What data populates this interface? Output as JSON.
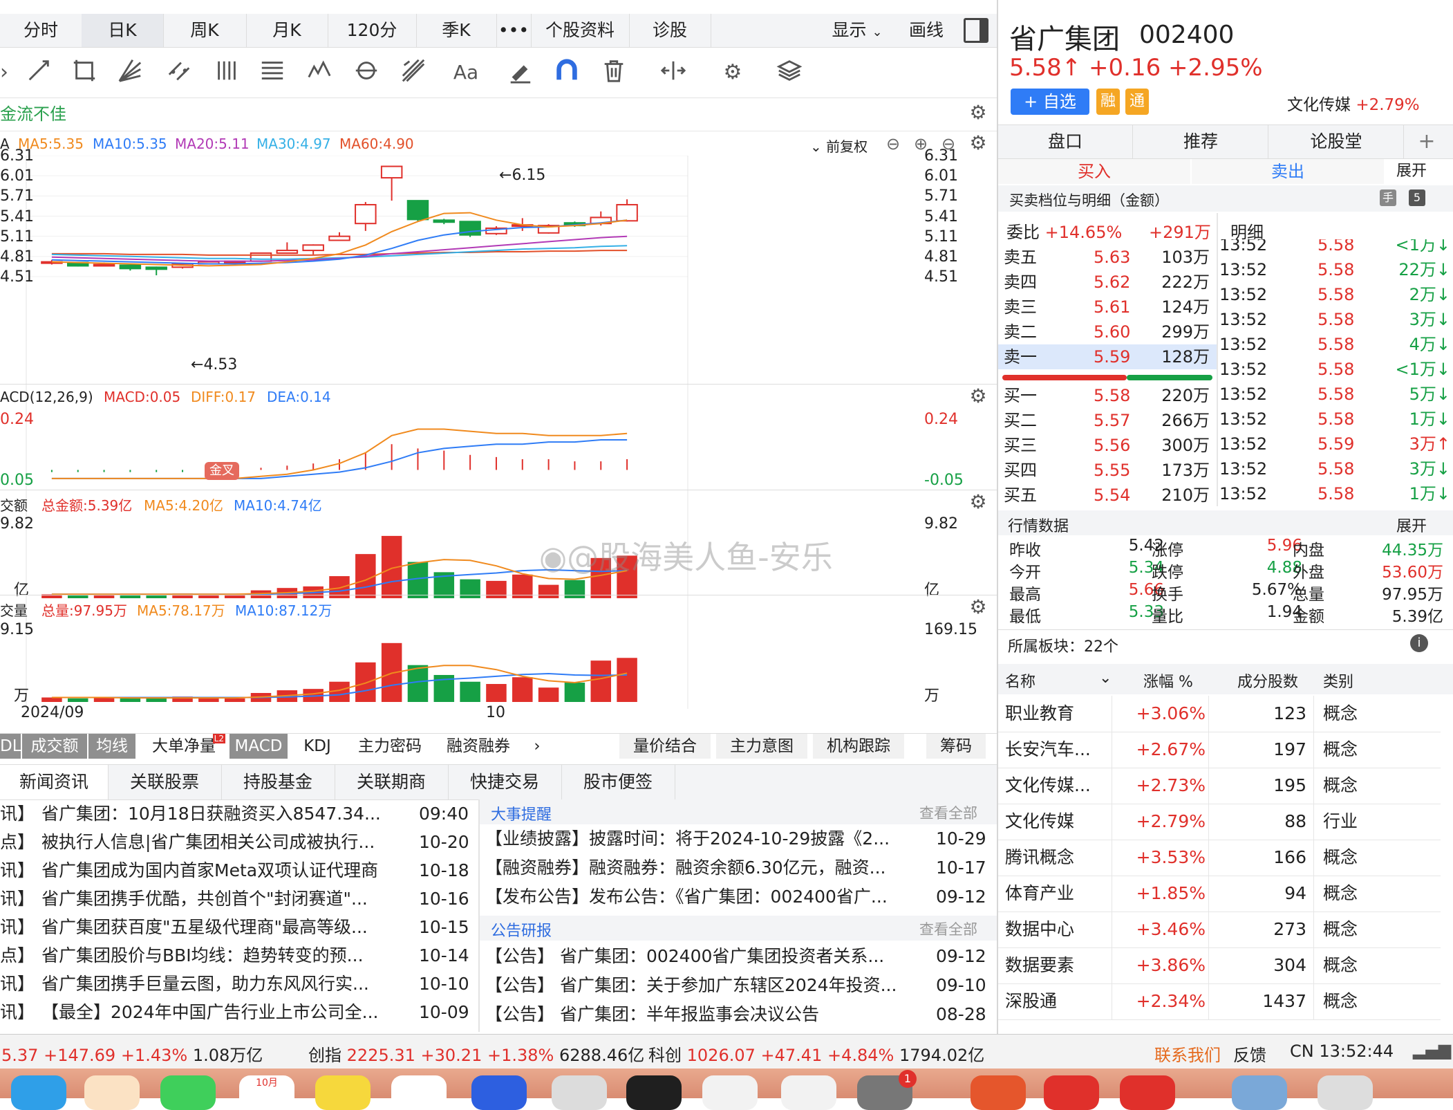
{
  "top_tabs": [
    "分时",
    "日K",
    "周K",
    "月K",
    "120分",
    "季K",
    "•••",
    "个股资料",
    "诊股"
  ],
  "top_right": {
    "display_label": "显示",
    "draw_label": "画线"
  },
  "signal_text": "金流不佳",
  "ma_line": {
    "prefix": "A",
    "ma5": "MA5:5.35",
    "ma10": "MA10:5.35",
    "ma20": "MA20:5.11",
    "ma30": "MA30:4.97",
    "ma60": "MA60:4.90",
    "adjust": "前复权"
  },
  "colors": {
    "up": "#e0302b",
    "down": "#16a045",
    "ma5": "#f08a1e",
    "ma10": "#2f7cf6",
    "ma20": "#b23ab6",
    "ma30": "#35b0e6",
    "ma60": "#e2502a"
  },
  "price_axis": [
    "6.31",
    "6.01",
    "5.71",
    "5.41",
    "5.11",
    "4.81",
    "4.51"
  ],
  "high_mark": "6.15",
  "low_mark": "4.53",
  "candles": [
    {
      "o": 4.73,
      "c": 4.73,
      "h": 4.76,
      "l": 4.69
    },
    {
      "o": 4.72,
      "c": 4.67,
      "h": 4.73,
      "l": 4.66
    },
    {
      "o": 4.69,
      "c": 4.69,
      "h": 4.72,
      "l": 4.66
    },
    {
      "o": 4.68,
      "c": 4.63,
      "h": 4.69,
      "l": 4.6
    },
    {
      "o": 4.65,
      "c": 4.62,
      "h": 4.66,
      "l": 4.53
    },
    {
      "o": 4.65,
      "c": 4.7,
      "h": 4.71,
      "l": 4.63
    },
    {
      "o": 4.7,
      "c": 4.73,
      "h": 4.74,
      "l": 4.69
    },
    {
      "o": 4.73,
      "c": 4.74,
      "h": 4.75,
      "l": 4.72
    },
    {
      "o": 4.74,
      "c": 4.86,
      "h": 4.87,
      "l": 4.73
    },
    {
      "o": 4.86,
      "c": 4.9,
      "h": 5.02,
      "l": 4.85
    },
    {
      "o": 4.9,
      "c": 4.98,
      "h": 4.99,
      "l": 4.84
    },
    {
      "o": 5.05,
      "c": 5.11,
      "h": 5.17,
      "l": 5.04
    },
    {
      "o": 5.3,
      "c": 5.58,
      "h": 5.62,
      "l": 5.19
    },
    {
      "o": 5.98,
      "c": 6.15,
      "h": 6.15,
      "l": 5.64
    },
    {
      "o": 5.64,
      "c": 5.36,
      "h": 5.64,
      "l": 5.33
    },
    {
      "o": 5.35,
      "c": 5.32,
      "h": 5.37,
      "l": 5.29
    },
    {
      "o": 5.33,
      "c": 5.13,
      "h": 5.33,
      "l": 5.1
    },
    {
      "o": 5.15,
      "c": 5.23,
      "h": 5.26,
      "l": 5.13
    },
    {
      "o": 5.27,
      "c": 5.28,
      "h": 5.38,
      "l": 5.19
    },
    {
      "o": 5.16,
      "c": 5.27,
      "h": 5.29,
      "l": 5.15
    },
    {
      "o": 5.31,
      "c": 5.27,
      "h": 5.33,
      "l": 5.25
    },
    {
      "o": 5.3,
      "c": 5.39,
      "h": 5.48,
      "l": 5.27
    },
    {
      "o": 5.34,
      "c": 5.58,
      "h": 5.66,
      "l": 5.33
    }
  ],
  "ma_series": {
    "ma5": [
      4.73,
      4.72,
      4.71,
      4.7,
      4.69,
      4.68,
      4.67,
      4.68,
      4.69,
      4.73,
      4.78,
      4.85,
      4.98,
      5.18,
      5.33,
      5.45,
      5.46,
      5.35,
      5.28,
      5.25,
      5.27,
      5.3,
      5.35
    ],
    "ma10": [
      4.76,
      4.75,
      4.74,
      4.73,
      4.72,
      4.71,
      4.7,
      4.7,
      4.71,
      4.72,
      4.74,
      4.77,
      4.83,
      4.93,
      5.05,
      5.13,
      5.18,
      5.21,
      5.24,
      5.25,
      5.28,
      5.31,
      5.35
    ],
    "ma20": [
      4.8,
      4.79,
      4.78,
      4.77,
      4.76,
      4.75,
      4.74,
      4.74,
      4.74,
      4.75,
      4.76,
      4.78,
      4.81,
      4.85,
      4.88,
      4.91,
      4.94,
      4.97,
      5.0,
      5.03,
      5.06,
      5.09,
      5.11
    ],
    "ma30": [
      4.84,
      4.83,
      4.82,
      4.81,
      4.8,
      4.79,
      4.78,
      4.78,
      4.77,
      4.77,
      4.78,
      4.79,
      4.8,
      4.82,
      4.84,
      4.86,
      4.88,
      4.9,
      4.92,
      4.93,
      4.94,
      4.96,
      4.97
    ],
    "ma60": [
      4.85,
      4.85,
      4.85,
      4.84,
      4.84,
      4.84,
      4.83,
      4.83,
      4.83,
      4.83,
      4.83,
      4.84,
      4.84,
      4.85,
      4.86,
      4.87,
      4.87,
      4.88,
      4.88,
      4.89,
      4.89,
      4.9,
      4.9
    ]
  },
  "macd": {
    "title": "ACD(12,26,9)",
    "macd": "MACD:0.05",
    "diff": "DIFF:0.17",
    "dea": "DEA:0.14",
    "axis_top": "0.24",
    "axis_bot": "-0.05",
    "axis_top_l": "0.24",
    "axis_bot_l": "0.05",
    "golden_cross": "金叉",
    "hist": [
      -0.01,
      -0.01,
      -0.01,
      -0.01,
      -0.01,
      -0.01,
      0.0,
      0.0,
      0.01,
      0.02,
      0.03,
      0.05,
      0.08,
      0.12,
      0.1,
      0.09,
      0.07,
      0.06,
      0.05,
      0.05,
      0.04,
      0.04,
      0.05
    ],
    "diff_s": [
      -0.04,
      -0.04,
      -0.04,
      -0.04,
      -0.04,
      -0.04,
      -0.04,
      -0.04,
      -0.03,
      -0.02,
      0.0,
      0.03,
      0.08,
      0.16,
      0.19,
      0.19,
      0.18,
      0.17,
      0.17,
      0.16,
      0.16,
      0.16,
      0.17
    ],
    "dea_s": [
      -0.04,
      -0.04,
      -0.04,
      -0.04,
      -0.04,
      -0.04,
      -0.04,
      -0.04,
      -0.04,
      -0.03,
      -0.02,
      -0.01,
      0.01,
      0.04,
      0.08,
      0.1,
      0.11,
      0.12,
      0.12,
      0.13,
      0.13,
      0.14,
      0.14
    ]
  },
  "amount": {
    "title": "交额",
    "total": "总金额:5.39亿",
    "ma5": "MA5:4.20亿",
    "ma10": "MA10:4.74亿",
    "axis_top": "9.82",
    "unit": "亿",
    "axis_top_l": "9.82",
    "unit_l": "亿",
    "values": [
      0.5,
      0.4,
      0.5,
      0.4,
      0.4,
      0.6,
      0.5,
      0.4,
      1.0,
      1.3,
      1.5,
      2.8,
      5.6,
      7.9,
      4.6,
      3.3,
      2.4,
      2.2,
      3.0,
      1.7,
      2.3,
      5.1,
      5.4
    ],
    "ma5_s": [
      0.5,
      0.5,
      0.5,
      0.5,
      0.5,
      0.5,
      0.5,
      0.5,
      0.6,
      0.7,
      0.9,
      1.3,
      2.3,
      3.8,
      4.5,
      4.9,
      4.8,
      4.1,
      3.1,
      2.5,
      2.4,
      2.9,
      3.5
    ],
    "ma10_s": [
      0.5,
      0.5,
      0.5,
      0.5,
      0.5,
      0.5,
      0.5,
      0.5,
      0.5,
      0.6,
      0.7,
      0.9,
      1.4,
      2.1,
      2.5,
      2.8,
      3.0,
      3.2,
      3.5,
      3.6,
      3.5,
      3.4,
      3.5
    ]
  },
  "volume": {
    "title": "交量",
    "total": "总量:97.95万",
    "ma5": "MA5:78.17万",
    "ma10": "MA10:87.12万",
    "axis_top": "169.15",
    "unit": "万",
    "axis_top_l": "9.15",
    "unit_l": "万",
    "values": [
      10,
      8,
      10,
      8,
      8,
      12,
      10,
      8,
      20,
      26,
      29,
      45,
      88,
      131,
      82,
      60,
      45,
      40,
      55,
      32,
      43,
      92,
      98
    ],
    "ma5_s": [
      10,
      10,
      10,
      9,
      9,
      9,
      9,
      9,
      11,
      14,
      18,
      26,
      42,
      64,
      75,
      81,
      81,
      72,
      57,
      47,
      43,
      52,
      64
    ],
    "ma10_s": [
      10,
      10,
      10,
      10,
      10,
      10,
      10,
      10,
      10,
      11,
      13,
      16,
      25,
      37,
      45,
      50,
      53,
      57,
      61,
      63,
      60,
      59,
      60
    ]
  },
  "date_labels": [
    "2024/09",
    "10"
  ],
  "indicator_tabs": [
    "DL",
    "成交额",
    "均线",
    "大单净量",
    "MACD",
    "KDJ",
    "主力密码",
    "融资融券"
  ],
  "indicator_badge": "L2",
  "indicator_right_tabs": [
    "量价结合",
    "主力意图",
    "机构跟踪",
    "筹码"
  ],
  "news_tabs": [
    "新闻资讯",
    "关联股票",
    "持股基金",
    "关联期商",
    "快捷交易",
    "股市便签"
  ],
  "news": [
    {
      "tag": "讯】",
      "title": "省广集团：10月18日获融资买入8547.34...",
      "date": "09:40"
    },
    {
      "tag": "点】",
      "title": "被执行人信息|省广集团相关公司成被执行...",
      "date": "10-20"
    },
    {
      "tag": "讯】",
      "title": "省广集团成为国内首家Meta双项认证代理商",
      "date": "10-18"
    },
    {
      "tag": "讯】",
      "title": "省广集团携手优酷，共创首个\"封闭赛道\"...",
      "date": "10-16"
    },
    {
      "tag": "讯】",
      "title": "省广集团获百度\"五星级代理商\"最高等级...",
      "date": "10-15"
    },
    {
      "tag": "点】",
      "title": "省广集团股价与BBI均线：趋势转变的预...",
      "date": "10-14"
    },
    {
      "tag": "讯】",
      "title": "省广集团携手巨量云图，助力东风风行实...",
      "date": "10-10"
    },
    {
      "tag": "讯】",
      "title": "【最全】2024年中国广告行业上市公司全...",
      "date": "10-09"
    }
  ],
  "events": {
    "header": "大事提醒",
    "view_all": "查看全部",
    "items": [
      {
        "text": "【业绩披露】披露时间：将于2024-10-29披露《2...",
        "date": "10-29"
      },
      {
        "text": "【融资融券】融资融券：融资余额6.30亿元，融资...",
        "date": "10-17"
      },
      {
        "text": "【发布公告】发布公告：《省广集团：002400省广...",
        "date": "09-12"
      }
    ]
  },
  "announcements": {
    "header": "公告研报",
    "view_all": "查看全部",
    "items": [
      {
        "text": "【公告】 省广集团：002400省广集团投资者关系...",
        "date": "09-12"
      },
      {
        "text": "【公告】 省广集团：关于参加广东辖区2024年投资...",
        "date": "09-10"
      },
      {
        "text": "【公告】 省广集团：半年报监事会决议公告",
        "date": "08-28"
      }
    ]
  },
  "watermark": "@股海美人鱼-安乐",
  "stock": {
    "name": "省广集团",
    "code": "002400",
    "price": "5.58",
    "arrow": "↑",
    "change": "+0.16",
    "pct": "+2.95%",
    "watch_btn": "+ 自选",
    "badge1": "融",
    "badge2": "通",
    "sector": "文化传媒",
    "sector_pct": "+2.79%"
  },
  "right_tabs": [
    "盘口",
    "推荐",
    "论股堂",
    "+"
  ],
  "buy_label": "买入",
  "sell_label": "卖出",
  "expand": "展开",
  "order_title": "买卖档位与明细（金额）",
  "order_icon1": "手",
  "order_icon2": "5",
  "weibi": {
    "label": "委比",
    "pct": "+14.65%",
    "amt": "+291万"
  },
  "detail_label": "明细",
  "asks": [
    {
      "name": "卖五",
      "price": "5.63",
      "vol": "103万"
    },
    {
      "name": "卖四",
      "price": "5.62",
      "vol": "222万"
    },
    {
      "name": "卖三",
      "price": "5.61",
      "vol": "124万"
    },
    {
      "name": "卖二",
      "price": "5.60",
      "vol": "299万"
    },
    {
      "name": "卖一",
      "price": "5.59",
      "vol": "128万"
    }
  ],
  "bids": [
    {
      "name": "买一",
      "price": "5.58",
      "vol": "220万"
    },
    {
      "name": "买二",
      "price": "5.57",
      "vol": "266万"
    },
    {
      "name": "买三",
      "price": "5.56",
      "vol": "300万"
    },
    {
      "name": "买四",
      "price": "5.55",
      "vol": "173万"
    },
    {
      "name": "买五",
      "price": "5.54",
      "vol": "210万"
    }
  ],
  "ticks": [
    {
      "t": "13:52",
      "p": "5.58",
      "v": "<1万↓",
      "dir": "down"
    },
    {
      "t": "13:52",
      "p": "5.58",
      "v": "22万↓",
      "dir": "down"
    },
    {
      "t": "13:52",
      "p": "5.58",
      "v": "2万↓",
      "dir": "down"
    },
    {
      "t": "13:52",
      "p": "5.58",
      "v": "3万↓",
      "dir": "down"
    },
    {
      "t": "13:52",
      "p": "5.58",
      "v": "4万↓",
      "dir": "down"
    },
    {
      "t": "13:52",
      "p": "5.58",
      "v": "<1万↓",
      "dir": "down"
    },
    {
      "t": "13:52",
      "p": "5.58",
      "v": "5万↓",
      "dir": "down"
    },
    {
      "t": "13:52",
      "p": "5.58",
      "v": "1万↓",
      "dir": "down"
    },
    {
      "t": "13:52",
      "p": "5.59",
      "v": "3万↑",
      "dir": "up"
    },
    {
      "t": "13:52",
      "p": "5.58",
      "v": "3万↓",
      "dir": "down"
    },
    {
      "t": "13:52",
      "p": "5.58",
      "v": "1万↓",
      "dir": "down"
    }
  ],
  "quote": {
    "title": "行情数据",
    "expand": "展开",
    "rows": [
      [
        {
          "l": "昨收",
          "v": "5.42",
          "c": ""
        },
        {
          "l": "涨停",
          "v": "5.96",
          "c": "red"
        },
        {
          "l": "内盘",
          "v": "44.35万",
          "c": "green"
        }
      ],
      [
        {
          "l": "今开",
          "v": "5.34",
          "c": "green"
        },
        {
          "l": "跌停",
          "v": "4.88",
          "c": "green"
        },
        {
          "l": "外盘",
          "v": "53.60万",
          "c": "red"
        }
      ],
      [
        {
          "l": "最高",
          "v": "5.66",
          "c": "red"
        },
        {
          "l": "换手",
          "v": "5.67%",
          "c": ""
        },
        {
          "l": "总量",
          "v": "97.95万",
          "c": ""
        }
      ],
      [
        {
          "l": "最低",
          "v": "5.33",
          "c": "green"
        },
        {
          "l": "量比",
          "v": "1.94",
          "c": ""
        },
        {
          "l": "金额",
          "v": "5.39亿",
          "c": ""
        }
      ]
    ]
  },
  "sectors_label": "所属板块：22个",
  "sector_head": [
    "名称",
    "涨幅 %",
    "成分股数",
    "类别"
  ],
  "sectors": [
    {
      "name": "职业教育",
      "pct": "+3.06%",
      "n": "123",
      "type": "概念"
    },
    {
      "name": "长安汽车...",
      "pct": "+2.67%",
      "n": "197",
      "type": "概念"
    },
    {
      "name": "文化传媒...",
      "pct": "+2.73%",
      "n": "195",
      "type": "概念"
    },
    {
      "name": "文化传媒",
      "pct": "+2.79%",
      "n": "88",
      "type": "行业"
    },
    {
      "name": "腾讯概念",
      "pct": "+3.53%",
      "n": "166",
      "type": "概念"
    },
    {
      "name": "体育产业",
      "pct": "+1.85%",
      "n": "94",
      "type": "概念"
    },
    {
      "name": "数据中心",
      "pct": "+3.46%",
      "n": "273",
      "type": "概念"
    },
    {
      "name": "数据要素",
      "pct": "+3.86%",
      "n": "304",
      "type": "概念"
    },
    {
      "name": "深股通",
      "pct": "+2.34%",
      "n": "1437",
      "type": "概念"
    }
  ],
  "status": {
    "idx1_val": "5.37",
    "idx1_chg": "+147.69",
    "idx1_pct": "+1.43%",
    "idx1_amt": "1.08万亿",
    "idx2_name": "创指",
    "idx2_val": "2225.31",
    "idx2_chg": "+30.21",
    "idx2_pct": "+1.38%",
    "idx2_amt": "6288.46亿",
    "idx3_name": "科创",
    "idx3_val": "1026.07",
    "idx3_chg": "+47.41",
    "idx3_pct": "+4.84%",
    "idx3_amt": "1794.02亿",
    "contact": "联系我们",
    "feedback": "反馈",
    "clock": "CN 13:52:44"
  },
  "dock_badge": "1",
  "dock_cal": "10月"
}
